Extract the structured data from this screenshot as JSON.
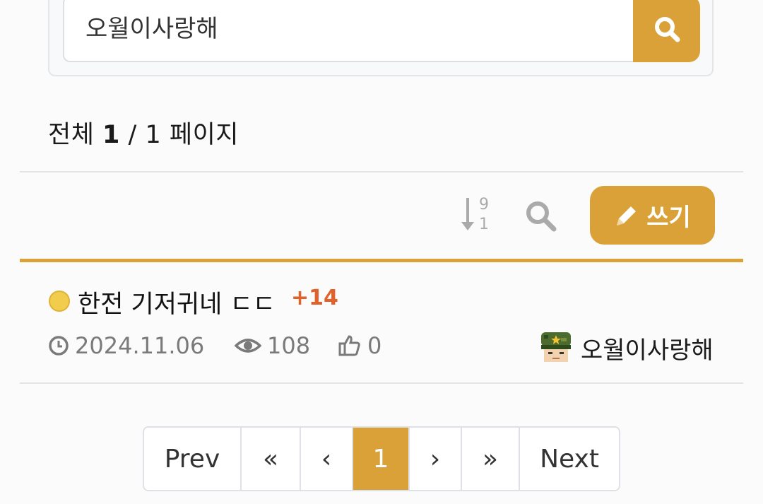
{
  "search": {
    "value": "오월이사랑해"
  },
  "page_info": {
    "prefix": "전체",
    "current": "1",
    "separator": "/",
    "total": "1",
    "suffix": "페이지"
  },
  "toolbar": {
    "sort_top": "9",
    "sort_bottom": "1",
    "write_label": "쓰기"
  },
  "post": {
    "title": "한전 기저귀네 ㄷㄷ",
    "comments": "+14",
    "date": "2024.11.06",
    "views": "108",
    "likes": "0",
    "author": "오월이사랑해"
  },
  "pagination": {
    "prev": "Prev",
    "first": "«",
    "prev_arrow": "‹",
    "current": "1",
    "next_arrow": "›",
    "last": "»",
    "next": "Next"
  },
  "colors": {
    "accent": "#d9a138",
    "comment": "#e0622a"
  },
  "icons": [
    "search-icon",
    "sort-numeric-icon",
    "pencil-icon",
    "clock-icon",
    "eye-icon",
    "thumbs-up-icon",
    "avatar-icon"
  ]
}
